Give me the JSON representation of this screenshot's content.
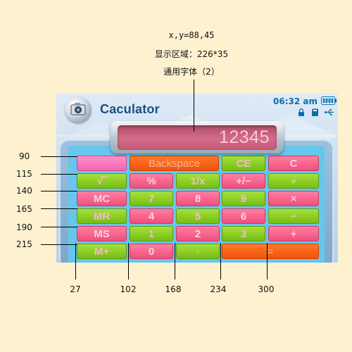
{
  "annotations": {
    "coords": "x,y=88,45",
    "display_area": "显示区域：226*35",
    "font": "通用字体（2）",
    "row_labels": [
      "90",
      "115",
      "140",
      "165",
      "190",
      "215"
    ],
    "col_labels": [
      "27",
      "102",
      "168",
      "234",
      "300"
    ]
  },
  "app": {
    "title": "Caculator",
    "icon": "camera-icon"
  },
  "status": {
    "time": "06:32 am",
    "icons": [
      "battery-icon",
      "lock-icon",
      "memory-card-icon",
      "usb-icon"
    ]
  },
  "display": {
    "value": "12345"
  },
  "keys": {
    "row1": [
      "",
      "Backspace",
      "CE",
      "C"
    ],
    "row2": [
      "√‾",
      "%",
      "1/x",
      "+/−",
      "÷"
    ],
    "row3": [
      "MC",
      "7",
      "8",
      "9",
      "×"
    ],
    "row4": [
      "MR",
      "4",
      "5",
      "6",
      "−"
    ],
    "row5": [
      "MS",
      "1",
      "2",
      "3",
      "+"
    ],
    "row6": [
      "M+",
      "0",
      "·",
      "="
    ]
  },
  "colors": {
    "green_key": "#8fd128",
    "pink_key": "#f6628a",
    "orange_key": "#f8621a",
    "magenta_key": "#f77ab8",
    "title": "#1c4f86",
    "time": "#0d6ea8"
  }
}
